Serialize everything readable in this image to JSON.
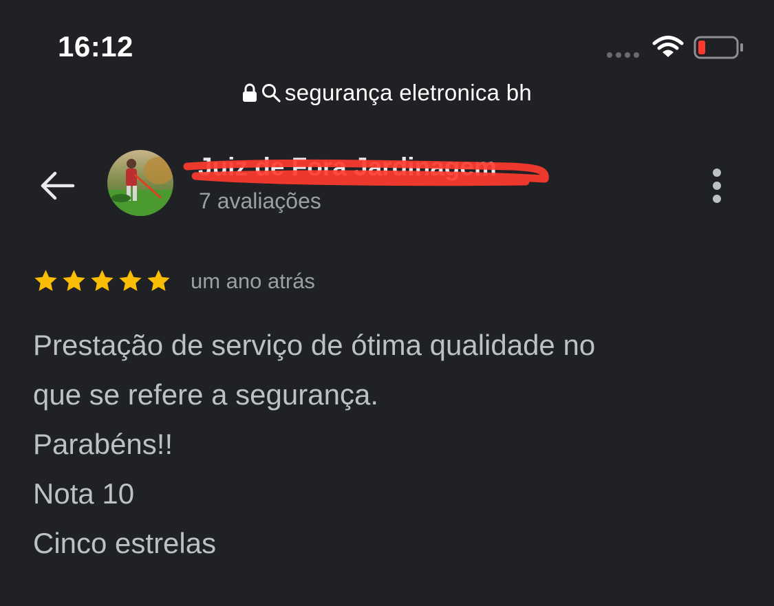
{
  "status_bar": {
    "time": "16:12",
    "battery_color": "#ff3b30"
  },
  "url_bar": {
    "query": "segurança eletronica bh",
    "icons": [
      "lock-icon",
      "search-icon"
    ]
  },
  "header": {
    "business_name": "Juiz de Fora Jardinagem",
    "review_count": "7 avaliações",
    "redaction_color": "#ff3b30",
    "icons": [
      "back-arrow-icon",
      "more-vert-icon"
    ]
  },
  "review": {
    "rating": 5,
    "max_rating": 5,
    "star_color": "#fbbc04",
    "time_ago": "um ano atrás",
    "lines": [
      "Prestação de serviço de ótima qualidade no",
      "que se refere a segurança.",
      "Parabéns!!",
      "Nota 10",
      "Cinco estrelas"
    ]
  }
}
